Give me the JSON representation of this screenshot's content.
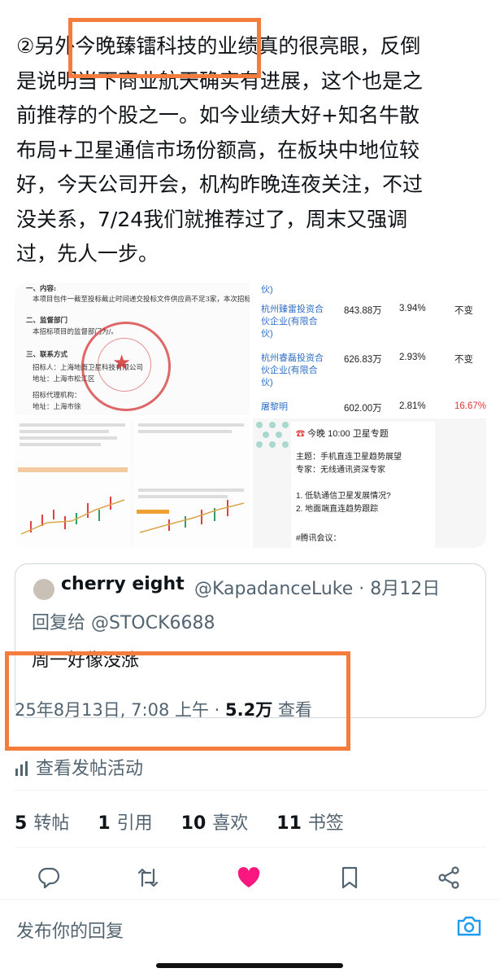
{
  "post": {
    "lines": [
      "②另外今晚臻镭科技的业绩真的很亮眼，反倒",
      "是说明当下商业航天确实有进展，这个也是之",
      "前推荐的个股之一。如今业绩大好+知名牛散",
      "布局+卫星通信市场份额高，在板块中地位较",
      "好，今天公司开会，机构昨晚连夜关注，不过",
      "没关系，7/24我们就推荐过了，周末又强调",
      "过，先人一步。"
    ]
  },
  "media": {
    "doc_lines": [
      "一、内容:",
      "本项目包件一截至投标截止时间递交投标文件供应商不足3家，本次招标失败。",
      "二、监督部门",
      "本招标项目的监督部门为/。",
      "三、联系方式",
      "招标人：上海地面卫星科技有限公司",
      "地址：上海市松江区",
      "招标代理机构：",
      "地址：上海市徐"
    ],
    "table_rows": [
      {
        "name": "伙)",
        "amount": "",
        "pct": "",
        "change": ""
      },
      {
        "name": "杭州臻雷投资合伙企业(有限合伙)",
        "amount": "843.88万",
        "pct": "3.94%",
        "change": "不变"
      },
      {
        "name": "杭州睿磊投资合伙企业(有限合伙)",
        "amount": "626.83万",
        "pct": "2.93%",
        "change": "不变"
      },
      {
        "name": "屠黎明",
        "amount": "602.00万",
        "pct": "2.81%",
        "change": "16.67%"
      }
    ],
    "notice": {
      "title": "今晚 10:00 卫星专题",
      "topic": "主题：手机直连卫星趋势展望",
      "expert": "专家：无线通讯资深专家",
      "q1": "1. 低轨通信卫星发展情况?",
      "q2": "2. 地面端直连趋势跟踪",
      "meeting": "#腾讯会议："
    }
  },
  "quote": {
    "name": "cherry eight",
    "handle": "@KapadanceLuke · 8月12日",
    "reply_prefix": "回复给",
    "reply_to": "@STOCK6688",
    "text": "周一好像没涨"
  },
  "meta": {
    "datetime": "25年8月13日, 7:08 上午 · ",
    "views": "5.2万",
    "views_label": " 查看"
  },
  "activity": {
    "label": "查看发帖活动"
  },
  "stats": {
    "reposts": "5",
    "reposts_label": "转帖",
    "quotes": "1",
    "quotes_label": "引用",
    "likes": "10",
    "likes_label": "喜欢",
    "bookmarks": "11",
    "bookmarks_label": "书签"
  },
  "reply": {
    "placeholder": "发布你的回复"
  },
  "colors": {
    "highlight": "#f47c3c",
    "like": "#f91880",
    "link": "#2f6fc4"
  },
  "icons": [
    "reply-icon",
    "retweet-icon",
    "heart-icon",
    "bookmark-icon",
    "share-icon",
    "camera-icon",
    "bar-chart-icon"
  ]
}
